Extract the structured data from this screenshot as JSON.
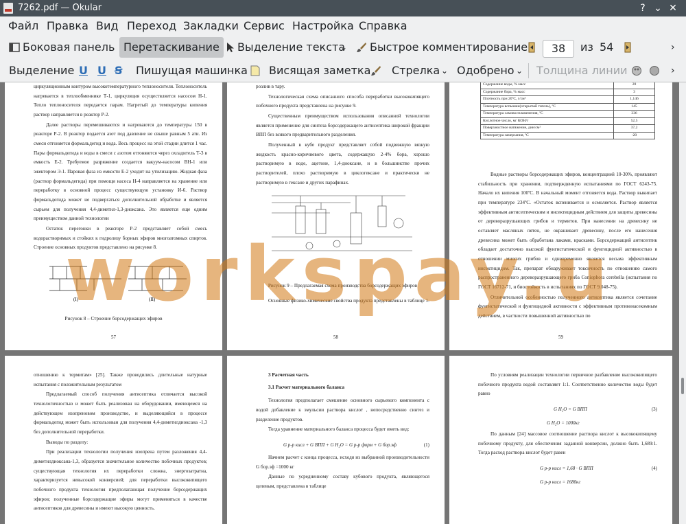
{
  "window": {
    "title": "7262.pdf — Okular"
  },
  "menu": [
    "Файл",
    "Правка",
    "Вид",
    "Переход",
    "Закладки",
    "Сервис",
    "Настройка",
    "Справка"
  ],
  "toolbar1": {
    "sidebar": "Боковая панель",
    "drag": "Перетаскивание",
    "text_select": "Выделение текста",
    "quick_comment": "Быстрое комментирование",
    "page_current": "38",
    "page_of": "из",
    "page_total": "54"
  },
  "toolbar2": {
    "highlight": "Выделение",
    "typewriter": "Пишущая машинка",
    "sticky_note": "Висящая заметка",
    "arrow": "Стрелка",
    "approved": "Одобрено",
    "line_width": "Толщина линии"
  },
  "watermark": "workspay.u",
  "pages": {
    "p57": {
      "paras": [
        "циркуляционным контуром высокотемпературного теплоносителя. Теплоноситель нагревается в теплообменнике Т-1, циркуляция осуществляется насосом Н-1. Тепло теплоносителя передается парам. Нагретый до температуры кипения раствор направляется в реактор Р-2.",
        "Далее растворы перемешиваются и нагреваются до температуры 150 в реакторе Р-2. В реактор подается азот под давление не свыше равным 5 ати. Из смеси отгоняется формальдегид и вода. Весь процесс на этой стадии длится 1 час. Пары формальдегида и воды в смеси с азотом отгоняются через охладитель Т-3 в емкость Е-2. Требуемое разряжение создается вакуум-насосом ВН-1 или эжектором Э-1. Паровая фаза из емкости Е-2 уходит на утилизацию. Жидкая фаза (раствор формальдегида) при помощи насоса Н-4 направляется на хранение или переработку в основной процесс существующую установку И-6. Раствор формальдегида может не подвергаться дополнительной обработке и является сырьем для получения 4,4-диметил-1,3-диоксана. Это является еще одним преимуществом данной технологии",
        "Остаток перегонки в реакторе Р-2 представляет собой смесь водорастворимых и стойких к гидролизу борных эфиров многоатомных спиртов. Строение основных продуктов представлено на рисунке 8."
      ],
      "label1": "(I)",
      "label2": "(II)",
      "caption": "Рисунок 8 – Строение борсодержащих эфиров",
      "num": "57"
    },
    "p58": {
      "paras": [
        "розлив в тару.",
        "Технологическая схема описанного способа переработки высококипящего побочного продукта представлена на рисунке 9.",
        "Существенным преимуществом использования описанной технологии является применение для синтеза борсодержащего антисептика широкой фракции ВПП без всякого предварительного разделения.",
        "Полученный в кубе продукт представляет собой подвижную вязкую жидкость красно-коричневого цвета, содержащую 2-4% бора, хорошо растворимую в воде, ацетоне, 1,4-диоксане, и в большинстве прочих растворителей, плохо растворимую в циклогексане и практически не растворимую в гексане и других парафинах."
      ],
      "caption": "Рисунок 9 – Предлагаемая схема производства борсодержащих эфиров",
      "after": "Основные физико-химические свойства продукта представлены в таблице 1.",
      "num": "58"
    },
    "p59": {
      "table": [
        [
          "Содержание воды, % масс",
          "20"
        ],
        [
          "Содержание бора, % масс",
          "3"
        ],
        [
          "Плотность при 20ºС, г/см³",
          "1,146"
        ],
        [
          "Температура вспышки(открытый тигель), ºС",
          "145"
        ],
        [
          "Температура самовоспламенения, ºС",
          "336"
        ],
        [
          "Кислотное число, мг КОН/г",
          "52,5"
        ],
        [
          "Поверхностное натяжение, дин/см²",
          "37,2"
        ],
        [
          "Температура замерзания, ºС",
          "-20"
        ]
      ],
      "paras": [
        "Водные растворы борсодержащих эфиров, концентрацией 10-30%, проявляют стабильность при хранении, подтвержденную испытаниями по ГОСТ 6243-75. Начало их кипения 100ºС. В начальный момент отгоняется вода. Раствор выкипает при температуре 234ºС. «Остаток вспенивается и осмоляется. Раствор является эффективным антисептическим и инсектицидным действием для защиты древесины от дереворазрушающих грибов и термитов. При нанесении на древесину не оставляет масляных пятен, не окрашивает древесину, после его нанесения древесина может быть обработана лаками, красками. Борсодержащий антисептик обладает достаточно высокой фунгистатической и фунгицидной активностью в отношении многих грибов и одновременно является весьма эффективным инсектицидом. Так, препарат обнаруживает токсичность по отношению самого распространенного дереворазрушающего гриба Coniophora cerebella (испытания по ГОСТ 16712-71, и биостойкость в испытаниях по ГОСТ 9.048-75).",
        "Отличительной особенностью полученного антисептика является сочетание фунгистатической и фунгицидной активности с эффективным противонасекомным действием, в частности повышенной активностью по"
      ],
      "num": "59"
    },
    "p60": {
      "paras": [
        "отношению к термитам» [25]. Также проводились длительные натурные испытания с положительным результатом",
        "Предлагаемый способ получения антисептика отличается высокой технологичностью и может быть реализован на оборудовании, имеющемся на действующем изопреновом производстве, и выделяющийся в процессе формальдегид может быть использован для получения 4,4-диметилдиоксана -1,3 без дополнительной переработки.",
        "Выводы по разделу:",
        "При реализации технологии получения изопрена путем разложения 4,4-диметилдиоксана-1,3, образуется значительное количество побочных продуктов; существующая технология их переработки сложна, энергозатратна, характеризуется невысокой конверсией; для переработки высококипящего побочного продукта технология предполагающая получение борсодержащих эфиров; полученные борсодержащие эфиры могут применяться в качестве антисептиков для древесины и имеют высокую ценность."
      ]
    },
    "p61": {
      "heading1": "3 Расчетная часть",
      "heading2": "3.1 Расчет материального баланса",
      "paras1": [
        "Технология предполагает смешение основного сырьевого компонента с водой добавление к эмульсии раствора кислот , непосредственно синтез и разделение продуктов.",
        "Тогда уравнение материального баланса процесса будет иметь вид:"
      ],
      "eq1": "G р-р кисл + G ВПП + G H₂O = G р-р форм + G бор.эф",
      "eq1num": "(1)",
      "paras2": [
        "Начнем расчет с конца процесса, исходя из выбранной производительности G бор.эф =1000 кг",
        "Данные по усредненному составу кубового продукта, являющегося целевым, представлена в таблице"
      ]
    },
    "p62": {
      "paras1": [
        "По условиям реализации технологии первичное разбавление высококипящего побочного продукта водой составляет 1:1. Соответственно количество воды будет равно"
      ],
      "eq3": "G H₂O = G ВПП",
      "eq3num": "(3)",
      "eq3b": "G H₂O = 1000кг",
      "paras2": [
        "По данным [24] массовое соотношение раствора кислот к высококипящему побочному продукту, для обеспечения заданной конверсии, должно быть 1,689:1. Тогда расход раствора кислот будет равен"
      ],
      "eq4": "G р-р кисл = 1,68 · G ВПП",
      "eq4num": "(4)",
      "eq4b": "G р-р кисл = 1680кг"
    }
  }
}
